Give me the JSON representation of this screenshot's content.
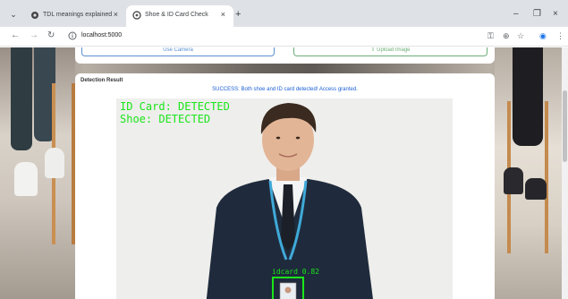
{
  "browser": {
    "tabs": [
      {
        "title": "TDL meanings explained",
        "active": false
      },
      {
        "title": "Shoe & ID Card Check",
        "active": true
      }
    ],
    "new_tab_symbol": "+",
    "tab_close_symbol": "×",
    "window_controls": {
      "minimize": "–",
      "restore": "❐",
      "close": "×"
    },
    "url": "localhost:5000",
    "nav": {
      "back": "←",
      "forward": "→",
      "reload": "↻"
    },
    "toolbar_icons": [
      "password-key-icon",
      "zoom-icon",
      "bookmark-star-icon",
      "profile-icon",
      "menu-kebab-icon"
    ],
    "toolbar_glyphs": {
      "key": "⚿",
      "zoom": "⊕",
      "star": "☆",
      "profile": "◉",
      "menu": "⋮"
    }
  },
  "upload": {
    "use_camera_label": "Use Camera",
    "upload_image_label": "⇧ Upload Image"
  },
  "result": {
    "title": "Detection Result",
    "message": "SUCCESS: Both shoe and ID card detected! Access granted.",
    "overlay": {
      "id_card_status": "ID Card: DETECTED",
      "shoe_status": "Shoe: DETECTED",
      "box_label": "idcard 0.82"
    }
  },
  "colors": {
    "accent_blue": "#1a5fd6",
    "detect_green": "#19e619",
    "camera_button": "#5b8fd1",
    "upload_button": "#6cae77"
  }
}
